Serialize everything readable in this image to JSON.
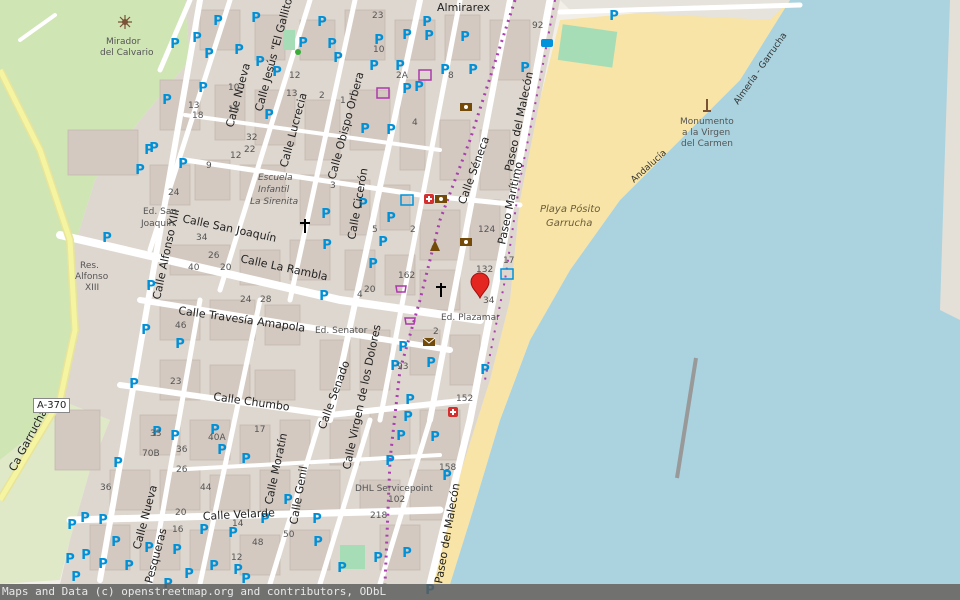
{
  "map": {
    "attribution": "Maps and Data (c) openstreetmap.org and contributors, ODbL",
    "parking_symbol": "P",
    "route_shield": "A-370",
    "streets": [
      {
        "id": "almirarex",
        "text": "Almirarex"
      },
      {
        "id": "calle-jesus",
        "text": "Calle Jesús \"El Gallito\""
      },
      {
        "id": "calle-nueva-n",
        "text": "Calle Nueva"
      },
      {
        "id": "calle-lucrecia",
        "text": "Calle Lucrecia"
      },
      {
        "id": "calle-obispo",
        "text": "Calle Obispo Orbera"
      },
      {
        "id": "calle-ciceron",
        "text": "Calle Cicerón"
      },
      {
        "id": "calle-seneca",
        "text": "Calle Séneca"
      },
      {
        "id": "paseo-maritimo",
        "text": "Paseo Marítimo"
      },
      {
        "id": "paseo-malecon-n",
        "text": "Paseo del Malecón"
      },
      {
        "id": "calle-san-joaquin",
        "text": "Calle San Joaquín"
      },
      {
        "id": "calle-alfonso",
        "text": "Calle Alfonso XIII"
      },
      {
        "id": "calle-rambla",
        "text": "Calle La Rambla"
      },
      {
        "id": "calle-travesia",
        "text": "Calle Travesía Amapola"
      },
      {
        "id": "calle-chumbo",
        "text": "Calle Chumbo"
      },
      {
        "id": "calle-senado",
        "text": "Calle Senado"
      },
      {
        "id": "calle-virgen",
        "text": "Calle Virgen de los Dolores"
      },
      {
        "id": "calle-moratin",
        "text": "Calle Moratín"
      },
      {
        "id": "calle-genil",
        "text": "Calle Genil"
      },
      {
        "id": "calle-velarde",
        "text": "Calle Velarde"
      },
      {
        "id": "calle-nueva-s",
        "text": "Calle Nueva"
      },
      {
        "id": "paseo-malecon-s",
        "text": "Paseo del Malecón"
      },
      {
        "id": "ca-garrucha",
        "text": "Ca Garrucha"
      },
      {
        "id": "pesqueras",
        "text": "Pesqueras"
      },
      {
        "id": "andalucia",
        "text": "Andalucía"
      },
      {
        "id": "almeria-garrucha",
        "text": "Almería - Garrucha"
      }
    ],
    "places": {
      "mirador": [
        "Mirador",
        "del Calvario"
      ],
      "escuela": [
        "Escuela",
        "Infantil",
        "La Sirenita"
      ],
      "ed_san_joaquin": [
        "Ed. San",
        "Joaquín"
      ],
      "res_alfonso": [
        "Res.",
        "Alfonso",
        "XIII"
      ],
      "ed_senator": "Ed. Senator",
      "ed_plazamar": "Ed. Plazamar",
      "playa": [
        "Playa Pósito",
        "Garrucha"
      ],
      "monumento": [
        "Monumento",
        "a la Virgen",
        "del Carmen"
      ],
      "dhl": [
        "DHL Servicepoint",
        "102"
      ]
    },
    "house_numbers": [
      "23",
      "92",
      "10",
      "2A",
      "12",
      "13",
      "10",
      "18",
      "15",
      "32",
      "22",
      "9",
      "12",
      "13",
      "2",
      "1",
      "3",
      "4",
      "2",
      "124",
      "132",
      "162",
      "17",
      "34",
      "24",
      "34",
      "26",
      "40",
      "20",
      "46",
      "24",
      "28",
      "20",
      "4",
      "2",
      "93",
      "152",
      "158",
      "218",
      "50",
      "48",
      "36",
      "12",
      "20",
      "16",
      "14",
      "17",
      "44",
      "40A",
      "70B",
      "36",
      "26",
      "5",
      "8",
      "23",
      "33"
    ],
    "colors": {
      "land": "#f2efe9",
      "building": "#d9d0c9",
      "water": "#aad3df",
      "beach": "#f7e4a6",
      "park": "#c8e6a4",
      "road": "#ffffff",
      "trunk": "#f5f4a0",
      "parking": "#0090d8",
      "marker": "#e3261f",
      "pedestrian_dots": "#aa3fb0"
    },
    "icons": [
      "viewpoint-icon",
      "church-icon",
      "school-icon",
      "pharmacy-icon",
      "bank-icon",
      "shop-icon",
      "post-office-icon",
      "monument-icon",
      "map-marker-icon",
      "tourism-info-icon",
      "bus-icon",
      "playground-icon"
    ]
  }
}
